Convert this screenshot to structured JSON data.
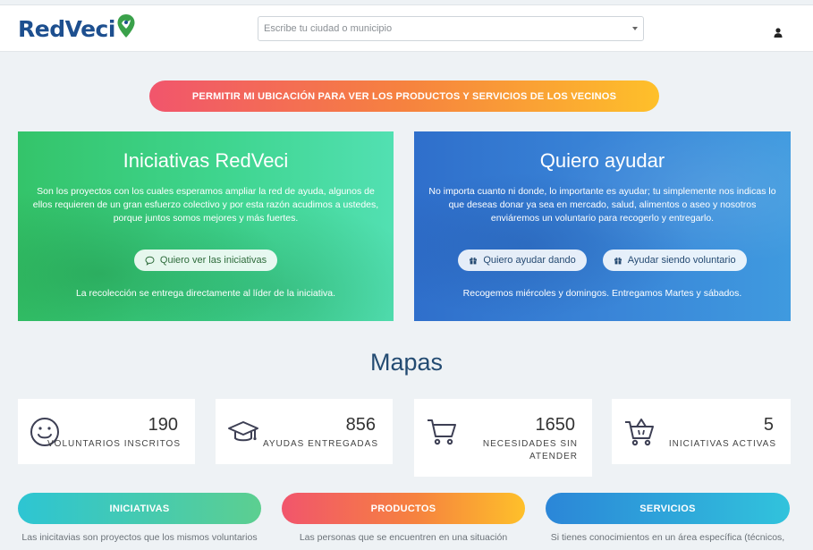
{
  "brand": {
    "name": "RedVeci",
    "blue": "#1d4f8f",
    "green": "#3aa14a"
  },
  "header": {
    "search_placeholder": "Escribe tu ciudad o municipio",
    "user_icon": "user-icon"
  },
  "location_button": "PERMITIR MI UBICACIÓN PARA VER LOS PRODUCTOS Y SERVICIOS DE LOS VECINOS",
  "hero_initiatives": {
    "title": "Iniciativas RedVeci",
    "description": "Son los proyectos con los cuales esperamos ampliar la red de ayuda, algunos de ellos requieren de un gran esfuerzo colectivo y por esta razón acudimos a ustedes, porque juntos somos mejores y más fuertes.",
    "button": "Quiero ver las iniciativas",
    "button_icon": "chat-bubble-icon",
    "note": "La recolección se entrega directamente al líder de la iniciativa."
  },
  "hero_help": {
    "title": "Quiero ayudar",
    "description": "No importa cuanto ni donde, lo importante es ayudar; tu simplemente nos indicas lo que deseas donar ya sea en mercado, salud, alimentos o aseo y nosotros enviáremos un voluntario para recogerlo y entregarlo.",
    "button_give": "Quiero ayudar dando",
    "button_volunteer": "Ayudar siendo voluntario",
    "button_icon": "gift-icon",
    "note": "Recogemos miércoles y domingos. Entregamos Martes y sábados."
  },
  "maps_title": "Mapas",
  "stats": [
    {
      "value": "190",
      "label": "VOLUNTARIOS INSCRITOS",
      "icon": "smiley-icon"
    },
    {
      "value": "856",
      "label": "AYUDAS ENTREGADAS",
      "icon": "graduation-cap-icon"
    },
    {
      "value": "1650",
      "label": "NECESIDADES SIN ATENDER",
      "icon": "cart-icon"
    },
    {
      "value": "5",
      "label": "INICIATIVAS ACTIVAS",
      "icon": "basket-icon"
    }
  ],
  "categories": [
    {
      "label": "INICIATIVAS",
      "text": "Las inicitavias son proyectos que los mismos voluntarios"
    },
    {
      "label": "PRODUCTOS",
      "text": "Las personas que se encuentren en una situación"
    },
    {
      "label": "SERVICIOS",
      "text": "Si tienes conocimientos en un área específica (técnicos,"
    }
  ]
}
